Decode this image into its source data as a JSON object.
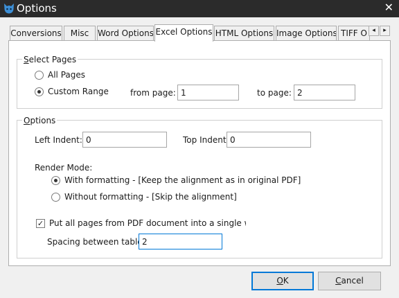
{
  "window": {
    "title": "Options",
    "close_glyph": "✕",
    "icon": "cat-logo-icon",
    "accent": "#2b2b2b"
  },
  "tabs": [
    {
      "label": "Conversions",
      "active": false
    },
    {
      "label": "Misc",
      "active": false
    },
    {
      "label": "Word Options",
      "active": false
    },
    {
      "label": "Excel Options",
      "active": true
    },
    {
      "label": "HTML Options",
      "active": false
    },
    {
      "label": "Image Options",
      "active": false
    },
    {
      "label": "TIFF O",
      "active": false
    }
  ],
  "tab_scroll": {
    "left": "◂",
    "right": "▸"
  },
  "select_pages": {
    "legend_first": "S",
    "legend_rest": "elect Pages",
    "all_pages": {
      "label": "All Pages",
      "checked": false
    },
    "custom_range": {
      "label": "Custom Range",
      "checked": true
    },
    "from_label": "from page:",
    "from_value": "1",
    "to_label": "to page:",
    "to_value": "2"
  },
  "options": {
    "legend_first": "O",
    "legend_rest": "ptions",
    "left_indent_label": "Left Indent:",
    "left_indent_value": "0",
    "top_indent_label": "Top Indent:",
    "top_indent_value": "0",
    "render_mode_label": "Render Mode:",
    "with_formatting": {
      "label": "With formatting - [Keep the alignment as in original PDF]",
      "checked": true
    },
    "without_formatting": {
      "label": "Without formatting - [Skip the alignment]",
      "checked": false
    },
    "single_sheet": {
      "label": "Put all pages from PDF document into a single workshe",
      "checked": true
    },
    "spacing_label": "Spacing between tables:",
    "spacing_value": "2"
  },
  "buttons": {
    "ok_mnemonic": "O",
    "ok_rest": "K",
    "cancel_mnemonic": "C",
    "cancel_rest": "ancel"
  }
}
